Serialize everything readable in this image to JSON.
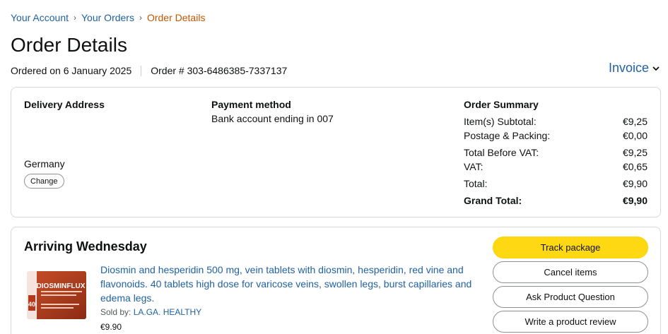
{
  "breadcrumb": {
    "items": [
      "Your Account",
      "Your Orders"
    ],
    "current": "Order Details",
    "separator": "›"
  },
  "page": {
    "title": "Order Details",
    "ordered_on": "Ordered on 6 January 2025",
    "order_number": "Order # 303-6486385-7337137",
    "invoice_label": "Invoice"
  },
  "delivery": {
    "title": "Delivery Address",
    "country": "Germany",
    "change_label": "Change"
  },
  "payment": {
    "title": "Payment method",
    "text": "Bank account ending in 007"
  },
  "summary": {
    "title": "Order Summary",
    "rows": [
      {
        "label": "Item(s) Subtotal:",
        "value": "€9,25"
      },
      {
        "label": "Postage & Packing:",
        "value": "€0,00"
      },
      {
        "label": "Total Before VAT:",
        "value": "€9,25"
      },
      {
        "label": "VAT:",
        "value": "€0,65"
      },
      {
        "label": "Total:",
        "value": "€9,90"
      },
      {
        "label": "Grand Total:",
        "value": "€9,90"
      }
    ]
  },
  "shipment": {
    "status": "Arriving Wednesday",
    "product": {
      "brand_text": "DIOSMINFLUX",
      "count_text": "40",
      "title": "Diosmin and hesperidin 500 mg, vein tablets with diosmin, hesperidin, red vine and flavonoids. 40 tablets high dose for varicose veins, swollen legs, burst capillaries and edema legs.",
      "sold_by_label": "Sold by:",
      "seller": "LA.GA. HEALTHY",
      "price": "€9.90"
    },
    "actions": {
      "track": "Track package",
      "cancel": "Cancel items",
      "ask": "Ask Product Question",
      "review": "Write a product review"
    }
  },
  "colors": {
    "link": "#2162a1",
    "breadcrumb_current": "#c45500",
    "primary_button": "#ffd814",
    "border": "#d5d9d9"
  }
}
